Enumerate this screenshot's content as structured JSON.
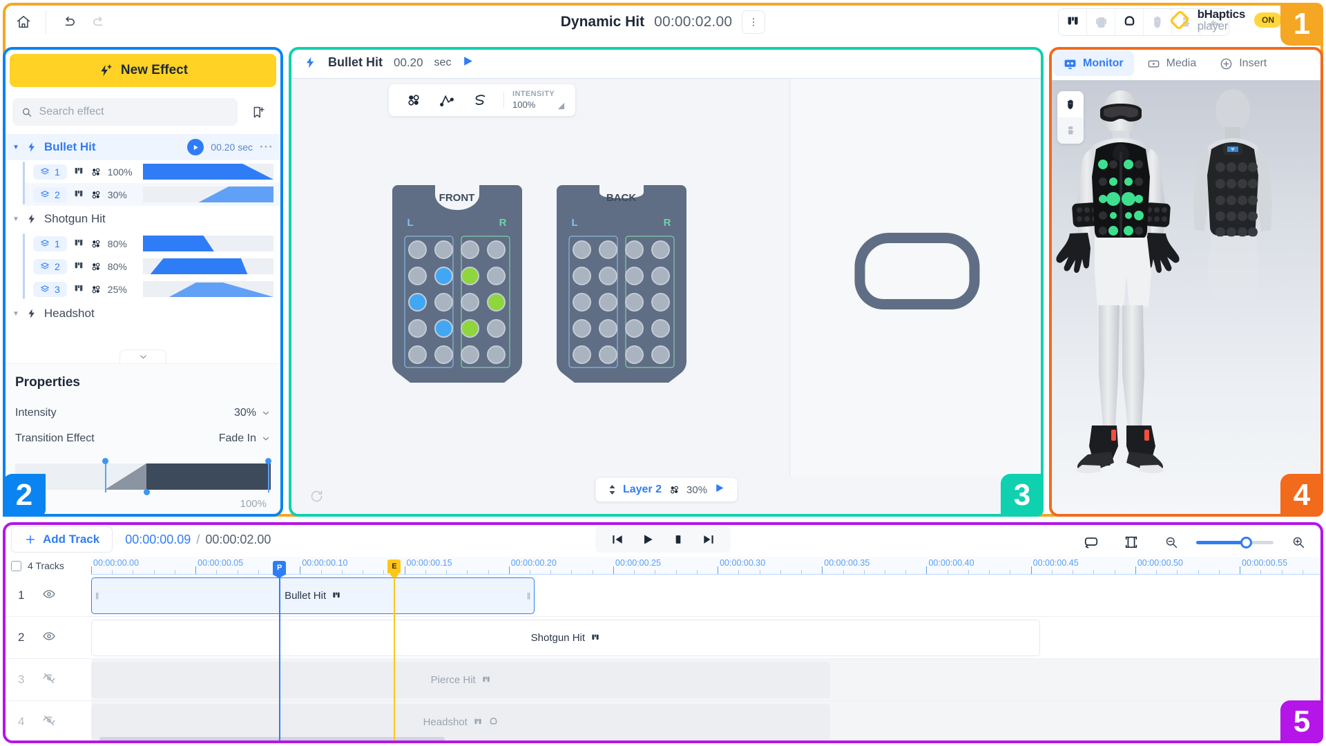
{
  "topbar": {
    "home_icon": "home-icon",
    "undo_icon": "undo-icon",
    "redo_icon": "redo-icon",
    "project_title": "Dynamic Hit",
    "project_duration": "00:00:02.00",
    "more_icon": "kebab-menu-icon",
    "devices": [
      {
        "name": "vest-icon",
        "active": true
      },
      {
        "name": "vest-back-icon",
        "active": false
      },
      {
        "name": "head-band-icon",
        "active": true
      },
      {
        "name": "glove-icon",
        "active": false
      },
      {
        "name": "arm-sleeve-icon",
        "active": false
      },
      {
        "name": "shoe-icon",
        "active": false
      }
    ],
    "logo_line1": "bHaptics",
    "logo_line2": "player",
    "power_state": "ON"
  },
  "left_panel": {
    "new_effect_label": "New Effect",
    "search_placeholder": "Search effect",
    "search_value": "",
    "bookmark_icon": "bookmark-add-icon",
    "effects": [
      {
        "name": "Bullet Hit",
        "selected": true,
        "duration": "00.20 sec",
        "layers": [
          {
            "index": "1",
            "intensity": "100%",
            "device": "vest-icon",
            "shape": "dots-icon",
            "curve": "ramp-down"
          },
          {
            "index": "2",
            "intensity": "30%",
            "device": "vest-icon",
            "shape": "dots-icon",
            "curve": "ramp-up"
          }
        ]
      },
      {
        "name": "Shotgun Hit",
        "selected": false,
        "duration": "",
        "layers": [
          {
            "index": "1",
            "intensity": "80%",
            "device": "vest-icon",
            "shape": "dots-icon",
            "curve": "ramp-down"
          },
          {
            "index": "2",
            "intensity": "80%",
            "device": "vest-icon",
            "shape": "dots-icon",
            "curve": "trapezoid"
          },
          {
            "index": "3",
            "intensity": "25%",
            "device": "vest-icon",
            "shape": "dots-icon",
            "curve": "peak-decay"
          }
        ]
      },
      {
        "name": "Headshot",
        "selected": false,
        "duration": "",
        "layers": []
      }
    ],
    "scroll_caret_icon": "chevron-down-icon",
    "properties": {
      "title": "Properties",
      "rows": [
        {
          "label": "Intensity",
          "value": "30%"
        },
        {
          "label": "Transition Effect",
          "value": "Fade In"
        }
      ],
      "envelope_value": "100%"
    }
  },
  "center_editor": {
    "effect_name": "Bullet Hit",
    "duration": "00.20",
    "duration_unit": "sec",
    "play_icon": "play-icon",
    "tools": [
      {
        "name": "dots-tool-icon",
        "active": true
      },
      {
        "name": "path-tool-icon",
        "active": false
      },
      {
        "name": "scribble-tool-icon",
        "active": false
      }
    ],
    "intensity_label": "INTENSITY",
    "intensity_value": "100%",
    "vests": [
      {
        "title": "FRONT",
        "left_label": "L",
        "right_label": "R",
        "left_dots": [
          [
            0,
            0
          ],
          [
            0,
            0
          ],
          [
            0,
            1
          ],
          [
            0,
            0
          ],
          [
            1,
            0
          ],
          [
            0,
            0
          ],
          [
            0,
            1
          ],
          [
            0,
            0
          ],
          [
            0,
            0
          ]
        ],
        "left_active": [
          "1,1",
          "2,0",
          "3,1"
        ],
        "right_active": [
          "1,0",
          "2,1",
          "3,0"
        ]
      },
      {
        "title": "BACK",
        "left_label": "L",
        "right_label": "R",
        "left_active": [],
        "right_active": []
      }
    ],
    "reset_icon": "reset-icon",
    "fullscreen_icon": "fullscreen-icon",
    "layer_pill": {
      "stepper_icon": "updown-stepper-icon",
      "name": "Layer 2",
      "shape_icon": "dots-icon",
      "intensity": "30%",
      "play_icon": "play-icon"
    }
  },
  "right_panel": {
    "tabs": [
      {
        "label": "Monitor",
        "icon": "monitor-icon",
        "active": true
      },
      {
        "label": "Media",
        "icon": "media-play-icon",
        "active": false
      },
      {
        "label": "Insert",
        "icon": "plus-circle-icon",
        "active": false
      }
    ],
    "stage_tools": [
      {
        "name": "pan-hand-icon",
        "active": true
      },
      {
        "name": "arm-device-icon",
        "active": false
      }
    ],
    "avatar": {
      "front_vest_active_color": "#3ee08f",
      "foot_accent_color": "#f0503c"
    }
  },
  "timeline": {
    "add_track_label": "Add Track",
    "add_icon": "plus-icon",
    "current_time": "00:00:00.09",
    "separator": "/",
    "total_time": "00:00:02.00",
    "transport": [
      {
        "name": "skip-start-icon"
      },
      {
        "name": "play-icon"
      },
      {
        "name": "stop-icon"
      },
      {
        "name": "skip-end-icon"
      }
    ],
    "loop_icon": "loop-icon",
    "fit-icon": "fit-to-screen-icon",
    "zoom_out_icon": "zoom-out-icon",
    "zoom_in_icon": "zoom-in-icon",
    "track_count_label": "4 Tracks",
    "ruler_labels": [
      "00:00:00.00",
      "00:00:00.05",
      "00:00:00.10",
      "00:00:00.15",
      "00:00:00.20",
      "00:00:00.25",
      "00:00:00.30",
      "00:00:00.35",
      "00:00:00.40",
      "00:00:00.45",
      "00:00:00.50",
      "00:00:00.55"
    ],
    "playhead_label": "P",
    "playhead_time": "00:00:00.09",
    "endmarker_label": "E",
    "endmarker_time": "00:00:00.145",
    "tracks": [
      {
        "num": "1",
        "eye": "visible",
        "dim": false,
        "clip": {
          "label": "Bullet Hit",
          "icon": "vest-icon",
          "style": "sel",
          "start_pct": 0.0,
          "end_pct": 36.0
        }
      },
      {
        "num": "2",
        "eye": "visible",
        "dim": false,
        "clip": {
          "label": "Shotgun Hit",
          "icon": "vest-icon",
          "style": "plain",
          "start_pct": 0.0,
          "end_pct": 77.0
        }
      },
      {
        "num": "3",
        "eye": "hidden",
        "dim": true,
        "clip": {
          "label": "Pierce Hit",
          "icon": "vest-icon",
          "style": "ghost",
          "start_pct": 0.0,
          "end_pct": 60.0
        }
      },
      {
        "num": "4",
        "eye": "hidden",
        "dim": true,
        "clip": {
          "label": "Headshot",
          "icon": "vest-icon",
          "icon2": "head-band-icon",
          "style": "ghost",
          "start_pct": 0.0,
          "end_pct": 60.0
        }
      }
    ]
  },
  "regions": [
    {
      "label": "1",
      "color": "#F5A623"
    },
    {
      "label": "2",
      "color": "#0A84F0"
    },
    {
      "label": "3",
      "color": "#0FD1B0"
    },
    {
      "label": "4",
      "color": "#F26A1B"
    },
    {
      "label": "5",
      "color": "#B515E8"
    }
  ]
}
